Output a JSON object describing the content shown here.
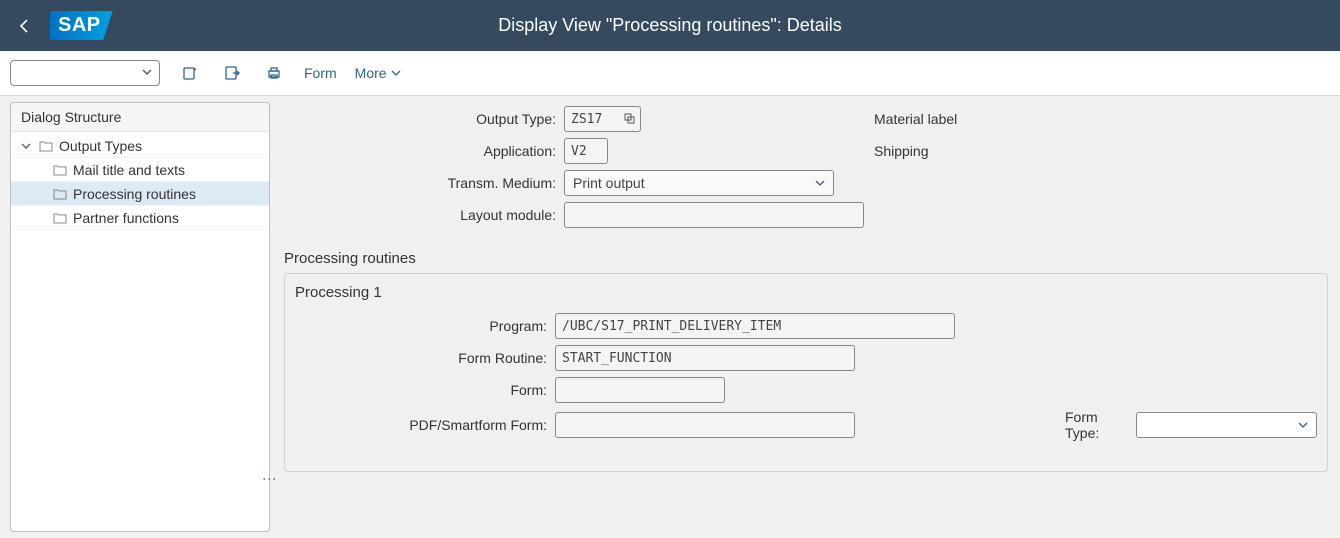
{
  "header": {
    "title": "Display View \"Processing routines\": Details",
    "logo": "SAP"
  },
  "toolbar": {
    "command": "",
    "form_label": "Form",
    "more_label": "More"
  },
  "sidebar": {
    "header": "Dialog Structure",
    "items": [
      {
        "label": "Output Types",
        "level": 0,
        "expanded": true,
        "selected": false,
        "icon": "folder-open"
      },
      {
        "label": "Mail title and texts",
        "level": 1,
        "expanded": false,
        "selected": false,
        "icon": "folder"
      },
      {
        "label": "Processing routines",
        "level": 1,
        "expanded": false,
        "selected": true,
        "icon": "folder-open"
      },
      {
        "label": "Partner functions",
        "level": 1,
        "expanded": false,
        "selected": false,
        "icon": "folder"
      }
    ]
  },
  "detail": {
    "output_type": {
      "label": "Output Type:",
      "value": "ZS17",
      "desc": "Material label"
    },
    "application": {
      "label": "Application:",
      "value": "V2",
      "desc": "Shipping"
    },
    "transm_medium": {
      "label": "Transm. Medium:",
      "value": "Print output"
    },
    "layout_module": {
      "label": "Layout module:",
      "value": ""
    },
    "section_title": "Processing routines",
    "panel_title": "Processing 1",
    "program": {
      "label": "Program:",
      "value": "/UBC/S17_PRINT_DELIVERY_ITEM"
    },
    "form_routine": {
      "label": "Form Routine:",
      "value": "START_FUNCTION"
    },
    "form": {
      "label": "Form:",
      "value": ""
    },
    "pdf_form": {
      "label": "PDF/Smartform Form:",
      "value": ""
    },
    "form_type": {
      "label": "Form Type:",
      "value": ""
    }
  }
}
